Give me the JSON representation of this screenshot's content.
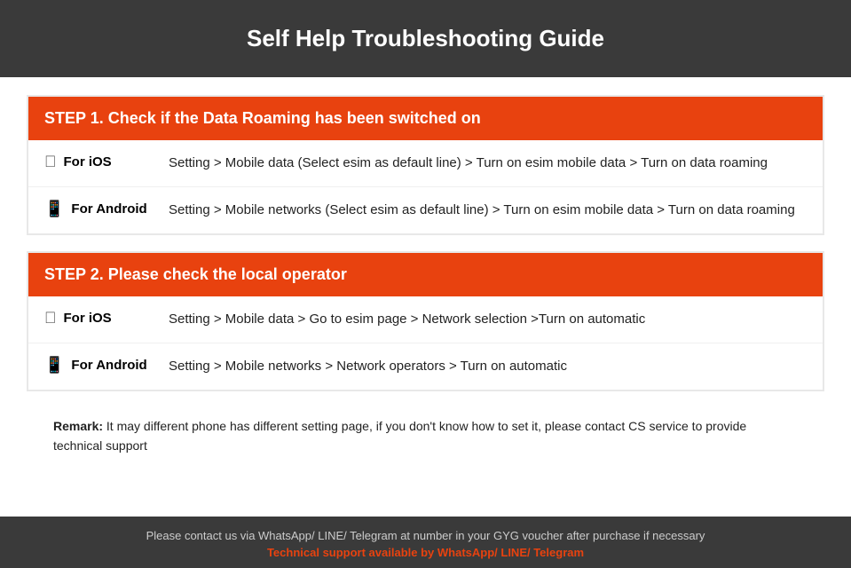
{
  "header": {
    "title": "Self Help Troubleshooting Guide"
  },
  "step1": {
    "heading": "STEP 1.  Check if the Data Roaming has been switched on",
    "ios_label": "For iOS",
    "ios_text": "Setting > Mobile data (Select esim as default line) > Turn on esim mobile data > Turn on data roaming",
    "android_label": "For Android",
    "android_text": "Setting > Mobile networks (Select esim as default line) > Turn on esim mobile data > Turn on data roaming"
  },
  "step2": {
    "heading": "STEP 2.  Please check the local operator",
    "ios_label": "For iOS",
    "ios_text": "Setting > Mobile data > Go to esim page > Network selection >Turn on automatic",
    "android_label": "For Android",
    "android_text": "Setting > Mobile networks > Network operators > Turn on automatic"
  },
  "remark": {
    "prefix": "Remark:",
    "text": " It may different phone has different setting page, if you don't know how to set it,  please contact CS service to provide technical support"
  },
  "footer": {
    "main_text": "Please contact us via WhatsApp/ LINE/ Telegram at number in your GYG voucher after purchase if necessary",
    "support_text": "Technical support available by WhatsApp/ LINE/ Telegram"
  }
}
